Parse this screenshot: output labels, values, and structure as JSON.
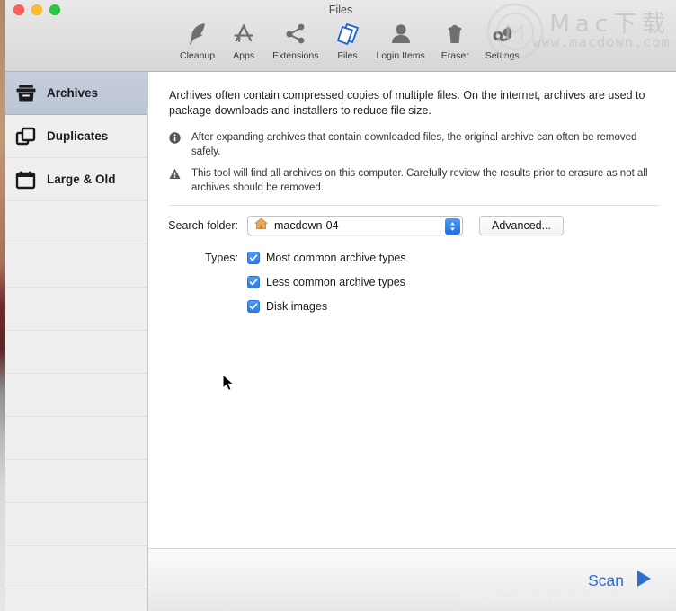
{
  "window": {
    "title": "Files",
    "traffic_lights": [
      "close",
      "minimize",
      "zoom"
    ]
  },
  "toolbar": {
    "items": [
      {
        "label": "Cleanup",
        "icon": "feather-icon",
        "active": false
      },
      {
        "label": "Apps",
        "icon": "app-store-icon",
        "active": false
      },
      {
        "label": "Extensions",
        "icon": "share-nodes-icon",
        "active": false
      },
      {
        "label": "Files",
        "icon": "files-icon",
        "active": true
      },
      {
        "label": "Login Items",
        "icon": "person-icon",
        "active": false
      },
      {
        "label": "Eraser",
        "icon": "trash-icon",
        "active": false
      },
      {
        "label": "Settings",
        "icon": "gear-eye-icon",
        "active": false
      }
    ],
    "active_color": "#1a62d8",
    "inactive_color": "#6f6f6f"
  },
  "watermark": {
    "brand_cn": "Mac下载",
    "brand_url": "www.macdown.com",
    "bottom_url": "https://blog.csdn.net/llhf688"
  },
  "sidebar": {
    "items": [
      {
        "label": "Archives",
        "icon": "archive-box-icon",
        "selected": true
      },
      {
        "label": "Duplicates",
        "icon": "duplicate-squares-icon",
        "selected": false
      },
      {
        "label": "Large & Old",
        "icon": "calendar-icon",
        "selected": false
      }
    ],
    "empty_row_count": 9,
    "selected_bg": "#c2cbdb"
  },
  "content": {
    "description": "Archives often contain compressed copies of multiple files. On the internet, archives are used to package downloads and installers to reduce file size.",
    "notes": [
      {
        "icon": "info-circle-icon",
        "text": "After expanding archives that contain downloaded files, the original archive can often be removed safely."
      },
      {
        "icon": "warning-triangle-icon",
        "text": "This tool will find all archives on this computer. Carefully review the results prior to erasure as not all archives should be removed."
      }
    ],
    "search_folder": {
      "label": "Search folder:",
      "value": "macdown-04",
      "icon": "home-folder-icon"
    },
    "advanced_button": "Advanced...",
    "types": {
      "label": "Types:",
      "options": [
        {
          "label": "Most common archive types",
          "checked": true
        },
        {
          "label": "Less common archive types",
          "checked": true
        },
        {
          "label": "Disk images",
          "checked": true
        }
      ]
    },
    "checkbox_color": "#2f7cf0"
  },
  "footer": {
    "scan_label": "Scan",
    "scan_icon": "play-triangle-icon",
    "scan_color": "#2a6ed2"
  }
}
